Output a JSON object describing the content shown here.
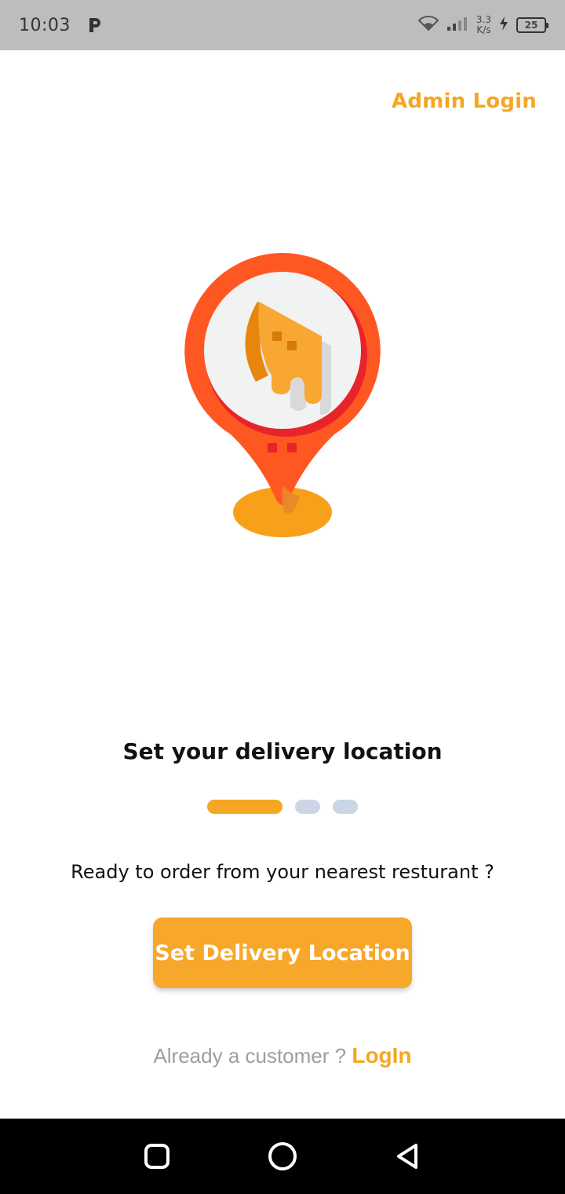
{
  "status_bar": {
    "time": "10:03",
    "speed_value": "3.3",
    "speed_unit": "K/s",
    "battery": "25",
    "icons": [
      "parking-app-icon",
      "wifi-icon",
      "signal-icon",
      "charging-icon",
      "battery-icon"
    ]
  },
  "header": {
    "admin_login": "Admin Login"
  },
  "hero": {
    "icon": "pizza-location-pin-icon"
  },
  "onboarding": {
    "title": "Set your delivery location",
    "pager": {
      "total": 3,
      "active": 1
    },
    "subtitle": "Ready to order from your nearest resturant ?"
  },
  "actions": {
    "cta_label": "Set Delivery Location",
    "already_text": "Already a customer ?",
    "login_label": "LogIn"
  },
  "nav": {
    "icons": [
      "recents-square-icon",
      "home-circle-icon",
      "back-triangle-icon"
    ]
  },
  "colors": {
    "accent": "#F5A623",
    "pin_red": "#FF5722",
    "status_bar": "#BDBDBD",
    "dot_inactive": "#CBD5E3"
  }
}
